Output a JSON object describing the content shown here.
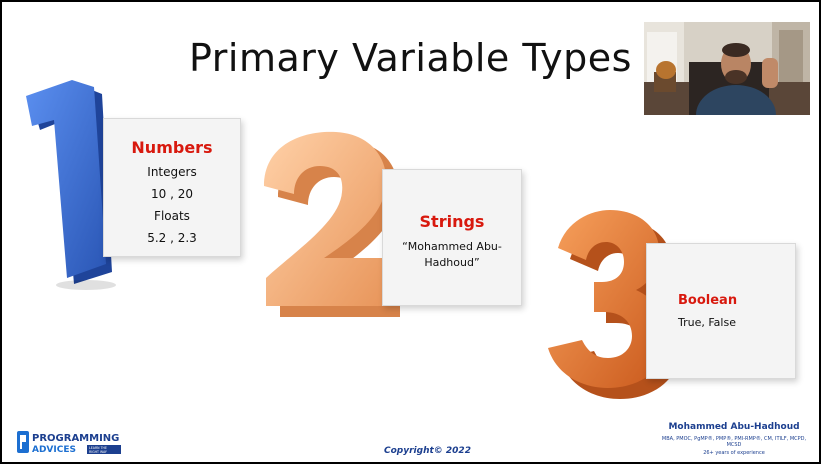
{
  "slide": {
    "title": "Primary Variable Types"
  },
  "numbers": {
    "one": "1",
    "two": "2",
    "three": "3"
  },
  "cards": {
    "numbers": {
      "heading": "Numbers",
      "line1": "Integers",
      "line2": "10 , 20",
      "line3": "Floats",
      "line4": "5.2 , 2.3"
    },
    "strings": {
      "heading": "Strings",
      "line1": "“Mohammed Abu-",
      "line2": "Hadhoud”"
    },
    "boolean": {
      "heading": "Boolean",
      "line1": "True, False"
    }
  },
  "footer": {
    "logo_line1": "PROGRAMMING",
    "logo_line2": "ADVICES",
    "logo_tag1": "LEARN THE",
    "logo_tag2": "RIGHT WAY",
    "copyright": "Copyright© 2022",
    "author_name": "Mohammed Abu-Hadhoud",
    "author_certs": "MBA, PMOC, PgMP®, PMP®, PMI-RMP®, CM, ITILF, MCPD, MCSD",
    "author_experience": "26+ years of experience"
  },
  "colors": {
    "one": "#3f6fd0",
    "two": "#f5b07a",
    "three": "#e8772d",
    "heading_red": "#d8190e",
    "brand_blue": "#1c3f8f"
  },
  "icons": {
    "logo": "programming-advices-logo"
  }
}
